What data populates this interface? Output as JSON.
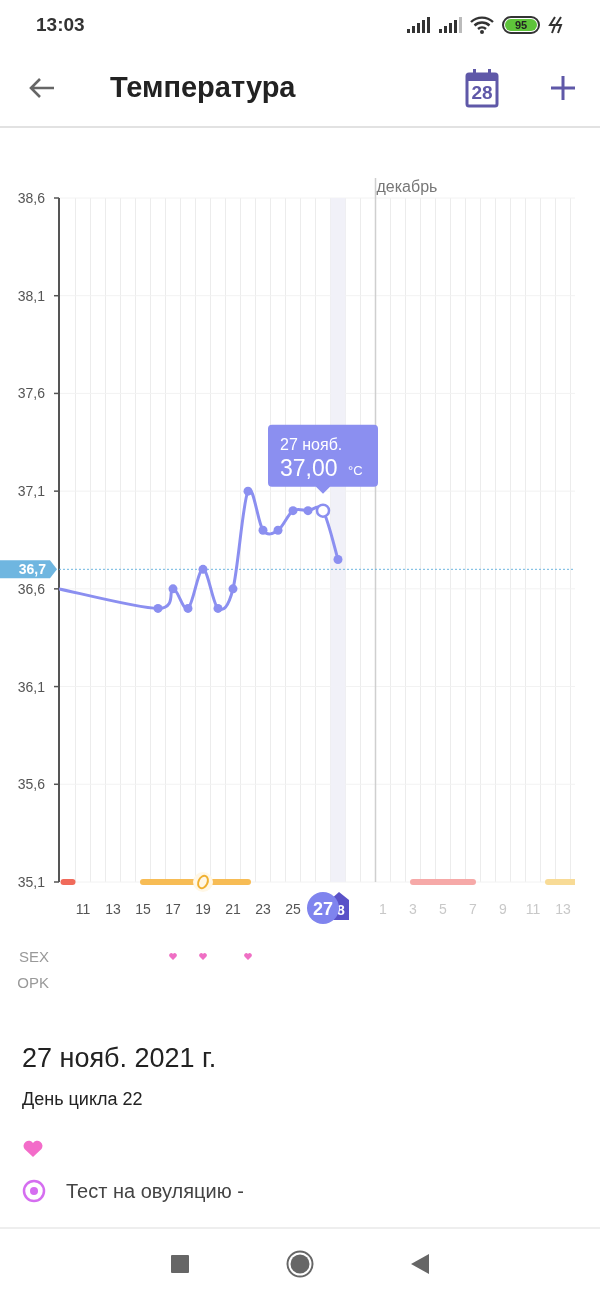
{
  "status_bar": {
    "time": "13:03",
    "battery": "95"
  },
  "app_bar": {
    "title": "Температура",
    "calendar_day": "28"
  },
  "chart": {
    "tooltip": {
      "date": "27 нояб.",
      "value": "37,00",
      "unit": "°C"
    },
    "selected_label": "27",
    "today_label": "8",
    "next_month_ticks": [
      "1",
      "3",
      "5",
      "7",
      "9",
      "11",
      "13"
    ],
    "row_labels": [
      "SEX",
      "OPK"
    ],
    "point_states": [
      {
        "selected": false
      },
      {
        "selected": false,
        "marks": [
          {
            "kind": "sex"
          }
        ]
      },
      {
        "selected": false
      },
      {
        "selected": false,
        "marks": [
          {
            "kind": "sex"
          },
          {
            "kind": "ovulation"
          }
        ]
      },
      {
        "selected": false
      },
      {
        "selected": false
      },
      {
        "selected": false,
        "marks": [
          {
            "kind": "sex"
          }
        ]
      },
      {
        "selected": false
      },
      {
        "selected": false
      },
      {
        "selected": false
      },
      {
        "selected": false
      },
      {
        "selected": true
      },
      {
        "selected": false
      }
    ],
    "chart_data": {
      "type": "line",
      "grid": true,
      "xlim": [
        9.4,
        43.8
      ],
      "ylim": [
        35.1,
        38.6
      ],
      "yticks": [
        {
          "value": 35.1,
          "label": "35,1"
        },
        {
          "value": 35.6,
          "label": "35,6"
        },
        {
          "value": 36.1,
          "label": "36,1"
        },
        {
          "value": 36.6,
          "label": "36,6"
        },
        {
          "value": 37.1,
          "label": "37,1"
        },
        {
          "value": 37.6,
          "label": "37,6"
        },
        {
          "value": 38.1,
          "label": "38,1"
        },
        {
          "value": 38.6,
          "label": "38,6"
        }
      ],
      "xticks": [
        {
          "value": 11,
          "label": "11"
        },
        {
          "value": 13,
          "label": "13"
        },
        {
          "value": 15,
          "label": "15"
        },
        {
          "value": 17,
          "label": "17"
        },
        {
          "value": 19,
          "label": "19"
        },
        {
          "value": 21,
          "label": "21"
        },
        {
          "value": 23,
          "label": "23"
        },
        {
          "value": 25,
          "label": "25"
        }
      ],
      "x": [
        9.4,
        16,
        17,
        18,
        19,
        20,
        21,
        22,
        23,
        24,
        25,
        26,
        27,
        28
      ],
      "series": [
        {
          "color": "#8b8ff0",
          "marker": "circle",
          "values": [
            36.6,
            36.5,
            36.6,
            36.5,
            36.7,
            36.5,
            36.6,
            37.1,
            36.9,
            36.9,
            37.0,
            37.0,
            37.0,
            36.75
          ]
        },
        {
          "color": "#f06a5a",
          "x": [
            9.7,
            10.3
          ],
          "values": [
            35.1,
            35.1
          ]
        },
        {
          "color": "#f7bc55",
          "x": [
            15,
            22
          ],
          "values": [
            35.1,
            35.1
          ]
        },
        {
          "color": "#f6a9a8",
          "x": [
            33,
            37
          ],
          "values": [
            35.1,
            35.1
          ]
        },
        {
          "color": "#f8db96",
          "x": [
            42,
            43.8
          ],
          "values": [
            35.1,
            35.1
          ]
        }
      ],
      "ref_lines": [
        {
          "axis": "y",
          "value": 36.7,
          "label": "36,7"
        },
        {
          "axis": "x",
          "value": 30.5,
          "label": "декабрь"
        }
      ],
      "bands": [
        {
          "axis": "x",
          "from": 27.5,
          "to": 28.5,
          "color": "#f1f1f8"
        }
      ]
    }
  },
  "details": {
    "date": "27 нояб. 2021 г.",
    "cycle_day": "День цикла 22",
    "entries": [
      {
        "kind": "sex"
      },
      {
        "kind": "ovulation_test",
        "text": "Тест на овуляцию -"
      }
    ]
  }
}
